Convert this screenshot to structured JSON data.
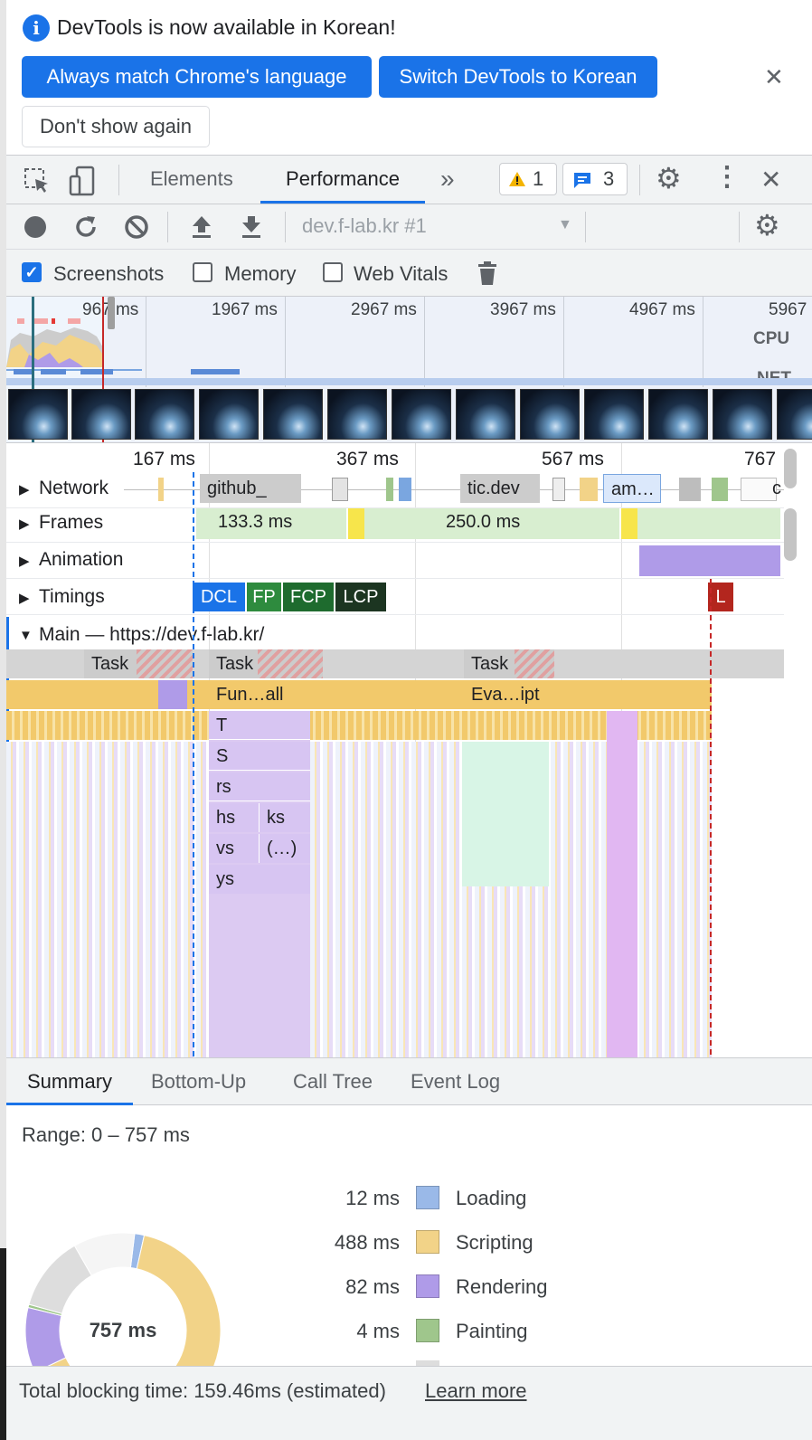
{
  "infobar": {
    "message": "DevTools is now available in Korean!",
    "info_icon": "i",
    "btn_match": "Always match Chrome's language",
    "btn_switch": "Switch DevTools to Korean",
    "btn_dont_show": "Don't show again",
    "close_icon": "✕"
  },
  "tabbar": {
    "tabs": [
      "Elements",
      "Performance"
    ],
    "more": "»",
    "warning_count": "1",
    "message_count": "3",
    "gear_icon": "⚙",
    "kebab_icon": "⋮",
    "close_icon": "✕"
  },
  "toolbar": {
    "target": "dev.f-lab.kr #1",
    "dropdown_arrow": "▼",
    "screenshots_label": "Screenshots",
    "screenshots_checked": true,
    "memory_label": "Memory",
    "web_vitals_label": "Web Vitals"
  },
  "overview": {
    "ticks": [
      "967 ms",
      "1967 ms",
      "2967 ms",
      "3967 ms",
      "4967 ms",
      "5967"
    ],
    "cpu_label": "CPU",
    "net_label": "NET"
  },
  "flame": {
    "ruler_ticks": [
      "167 ms",
      "367 ms",
      "567 ms",
      "767"
    ],
    "tracks": {
      "network": "Network",
      "frames": "Frames",
      "animation": "Animation",
      "timings": "Timings",
      "main": "Main — https://dev.f-lab.kr/"
    },
    "network_items": [
      "github_",
      "tic.dev",
      "am…",
      "c"
    ],
    "frame_durations": [
      "133.3 ms",
      "250.0 ms"
    ],
    "timing_markers": [
      "DCL",
      "FP",
      "FCP",
      "LCP",
      "L"
    ],
    "task_labels": [
      "Task",
      "Task",
      "Task"
    ],
    "call_labels": [
      "Fun…all",
      "Eva…ipt"
    ],
    "stack_labels": [
      "T",
      "S",
      "rs",
      "hs",
      "ks",
      "vs",
      "(…)",
      "ys"
    ]
  },
  "bottom": {
    "tabs": [
      "Summary",
      "Bottom-Up",
      "Call Tree",
      "Event Log"
    ],
    "range": "Range: 0 – 757 ms",
    "total": "757 ms",
    "categories": [
      {
        "value": "12 ms",
        "label": "Loading",
        "color": "#9ab9e8"
      },
      {
        "value": "488 ms",
        "label": "Scripting",
        "color": "#f2d388"
      },
      {
        "value": "82 ms",
        "label": "Rendering",
        "color": "#af9be8"
      },
      {
        "value": "4 ms",
        "label": "Painting",
        "color": "#9fc68c"
      }
    ],
    "footer_text": "Total blocking time: 159.46ms (estimated)",
    "learn_more": "Learn more"
  }
}
